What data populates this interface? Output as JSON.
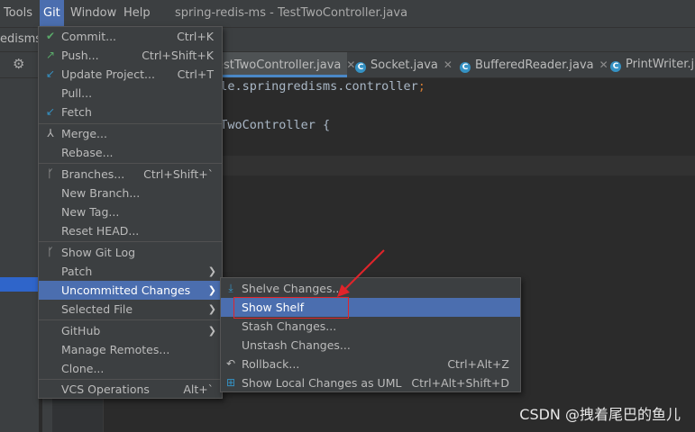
{
  "menubar": {
    "items": [
      "Tools",
      "Git",
      "Window",
      "Help"
    ],
    "title": "spring-redis-ms - TestTwoController.java"
  },
  "project": {
    "label": "edisms"
  },
  "tabs": [
    {
      "label": "estTwoController.java",
      "active": true
    },
    {
      "label": "Socket.java"
    },
    {
      "label": "BufferedReader.java"
    },
    {
      "label": "PrintWriter.jav"
    }
  ],
  "code": {
    "line1": "mple.springredisms.controller",
    "line1_end": ";",
    "line2": "stTwoController {"
  },
  "git_menu": {
    "items": [
      {
        "label": "Commit...",
        "shortcut": "Ctrl+K",
        "icon": "check-icon"
      },
      {
        "label": "Push...",
        "shortcut": "Ctrl+Shift+K",
        "icon": "push-arrow-icon"
      },
      {
        "label": "Update Project...",
        "shortcut": "Ctrl+T",
        "icon": "update-arrow-icon"
      },
      {
        "label": "Pull...",
        "shortcut": ""
      },
      {
        "label": "Fetch",
        "shortcut": "",
        "icon": "fetch-icon"
      },
      {
        "label": "Merge...",
        "shortcut": "",
        "icon": "merge-icon"
      },
      {
        "label": "Rebase...",
        "shortcut": ""
      },
      {
        "label": "Branches...",
        "shortcut": "Ctrl+Shift+`",
        "icon": "branch-icon"
      },
      {
        "label": "New Branch...",
        "shortcut": ""
      },
      {
        "label": "New Tag...",
        "shortcut": ""
      },
      {
        "label": "Reset HEAD...",
        "shortcut": ""
      },
      {
        "label": "Show Git Log",
        "shortcut": "",
        "icon": "git-log-icon"
      },
      {
        "label": "Patch",
        "shortcut": ""
      },
      {
        "label": "Uncommitted Changes",
        "shortcut": ""
      },
      {
        "label": "Selected File",
        "shortcut": ""
      },
      {
        "label": "GitHub",
        "shortcut": ""
      },
      {
        "label": "Manage Remotes...",
        "shortcut": ""
      },
      {
        "label": "Clone...",
        "shortcut": ""
      },
      {
        "label": "VCS Operations",
        "shortcut": "Alt+`"
      }
    ]
  },
  "sub_menu": {
    "items": [
      {
        "label": "Shelve Changes...",
        "shortcut": "",
        "icon": "shelve-icon"
      },
      {
        "label": "Show Shelf",
        "shortcut": ""
      },
      {
        "label": "Stash Changes...",
        "shortcut": ""
      },
      {
        "label": "Unstash Changes...",
        "shortcut": ""
      },
      {
        "label": "Rollback...",
        "shortcut": "Ctrl+Alt+Z",
        "icon": "rollback-icon"
      },
      {
        "label": "Show Local Changes as UML",
        "shortcut": "Ctrl+Alt+Shift+D",
        "icon": "uml-icon"
      }
    ]
  },
  "watermark": "CSDN @拽着尾巴的鱼儿",
  "colors": {
    "highlight": "#4b6eaf",
    "annotation": "#e0242a",
    "editor_bg": "#2b2b2b",
    "panel_bg": "#3c3f41"
  }
}
